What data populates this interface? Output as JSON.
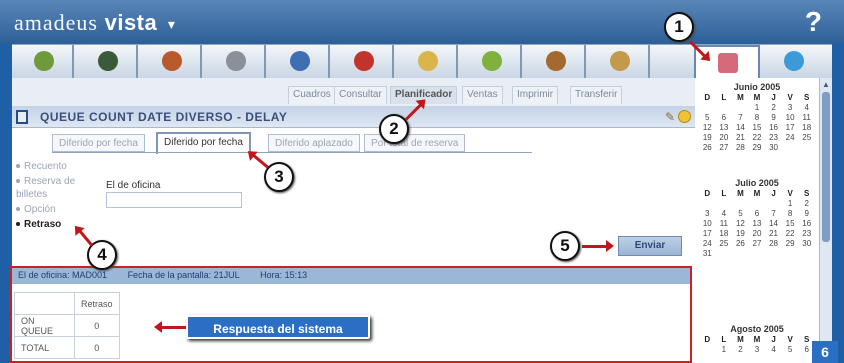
{
  "header": {
    "brand_light": "amadeus",
    "brand_bold": "vista",
    "brand_caret": "▾",
    "help": "?"
  },
  "iconbar": {
    "icons": [
      "tree-icon",
      "globe-icon",
      "hotel-icon",
      "car-icon",
      "bus-icon",
      "person-icon",
      "tools-icon",
      "world-icon",
      "luggage-icon",
      "calendar-tool-icon",
      "info-icon"
    ]
  },
  "subtabs": [
    "Cuadros",
    "Consultar",
    "Planificador",
    "Ventas",
    "Imprimir",
    "Transferir"
  ],
  "subtab_active": "Planificador",
  "page": {
    "title": "QUEUE COUNT DATE DIVERSO - DELAY"
  },
  "innertabs": [
    "Diferido por fecha",
    "Diferido por fecha",
    "Diferido aplazado",
    "Por total de reserva"
  ],
  "leftnav": [
    {
      "label": "Recuento"
    },
    {
      "label": "Reserva de billetes"
    },
    {
      "label": "Opción"
    },
    {
      "label": "Retraso"
    }
  ],
  "form": {
    "label": "El de oficina",
    "value": ""
  },
  "actions": {
    "send_label": "Enviar"
  },
  "result": {
    "header": {
      "office": "El de oficina: MAD001",
      "date": "Fecha de la pantalla: 21JUL",
      "time": "Hora: 15:13"
    },
    "column": "Retraso",
    "rows": [
      {
        "label": "ON QUEUE",
        "value": "0"
      },
      {
        "label": "TOTAL",
        "value": "0"
      }
    ]
  },
  "callout": {
    "text": "Respuesta del sistema"
  },
  "badges": [
    "1",
    "2",
    "3",
    "4",
    "5"
  ],
  "calendar": [
    {
      "title": "Junio 2005",
      "days": [
        "D",
        "L",
        "M",
        "M",
        "J",
        "V",
        "S",
        "",
        "",
        "",
        "1",
        "2",
        "3",
        "4",
        "5",
        "6",
        "7",
        "8",
        "9",
        "10",
        "11",
        "12",
        "13",
        "14",
        "15",
        "16",
        "17",
        "18",
        "19",
        "20",
        "21",
        "22",
        "23",
        "24",
        "25",
        "26",
        "27",
        "28",
        "29",
        "30",
        "",
        ""
      ]
    },
    {
      "title": "Julio 2005",
      "days": [
        "D",
        "L",
        "M",
        "M",
        "J",
        "V",
        "S",
        "",
        "",
        "",
        "",
        "",
        "1",
        "2",
        "3",
        "4",
        "5",
        "6",
        "7",
        "8",
        "9",
        "10",
        "11",
        "12",
        "13",
        "14",
        "15",
        "16",
        "17",
        "18",
        "19",
        "20",
        "21",
        "22",
        "23",
        "24",
        "25",
        "26",
        "27",
        "28",
        "29",
        "30",
        "31",
        "",
        "",
        "",
        "",
        "",
        ""
      ]
    },
    {
      "title": "Agosto 2005",
      "days": [
        "D",
        "L",
        "M",
        "M",
        "J",
        "V",
        "S",
        "",
        "1",
        "2",
        "3",
        "4",
        "5",
        "6"
      ]
    }
  ],
  "page_number": "6",
  "colors": {
    "accent": "#1f5fa6",
    "annotation_red": "#c3161c",
    "callout_blue": "#2a6fc4"
  }
}
